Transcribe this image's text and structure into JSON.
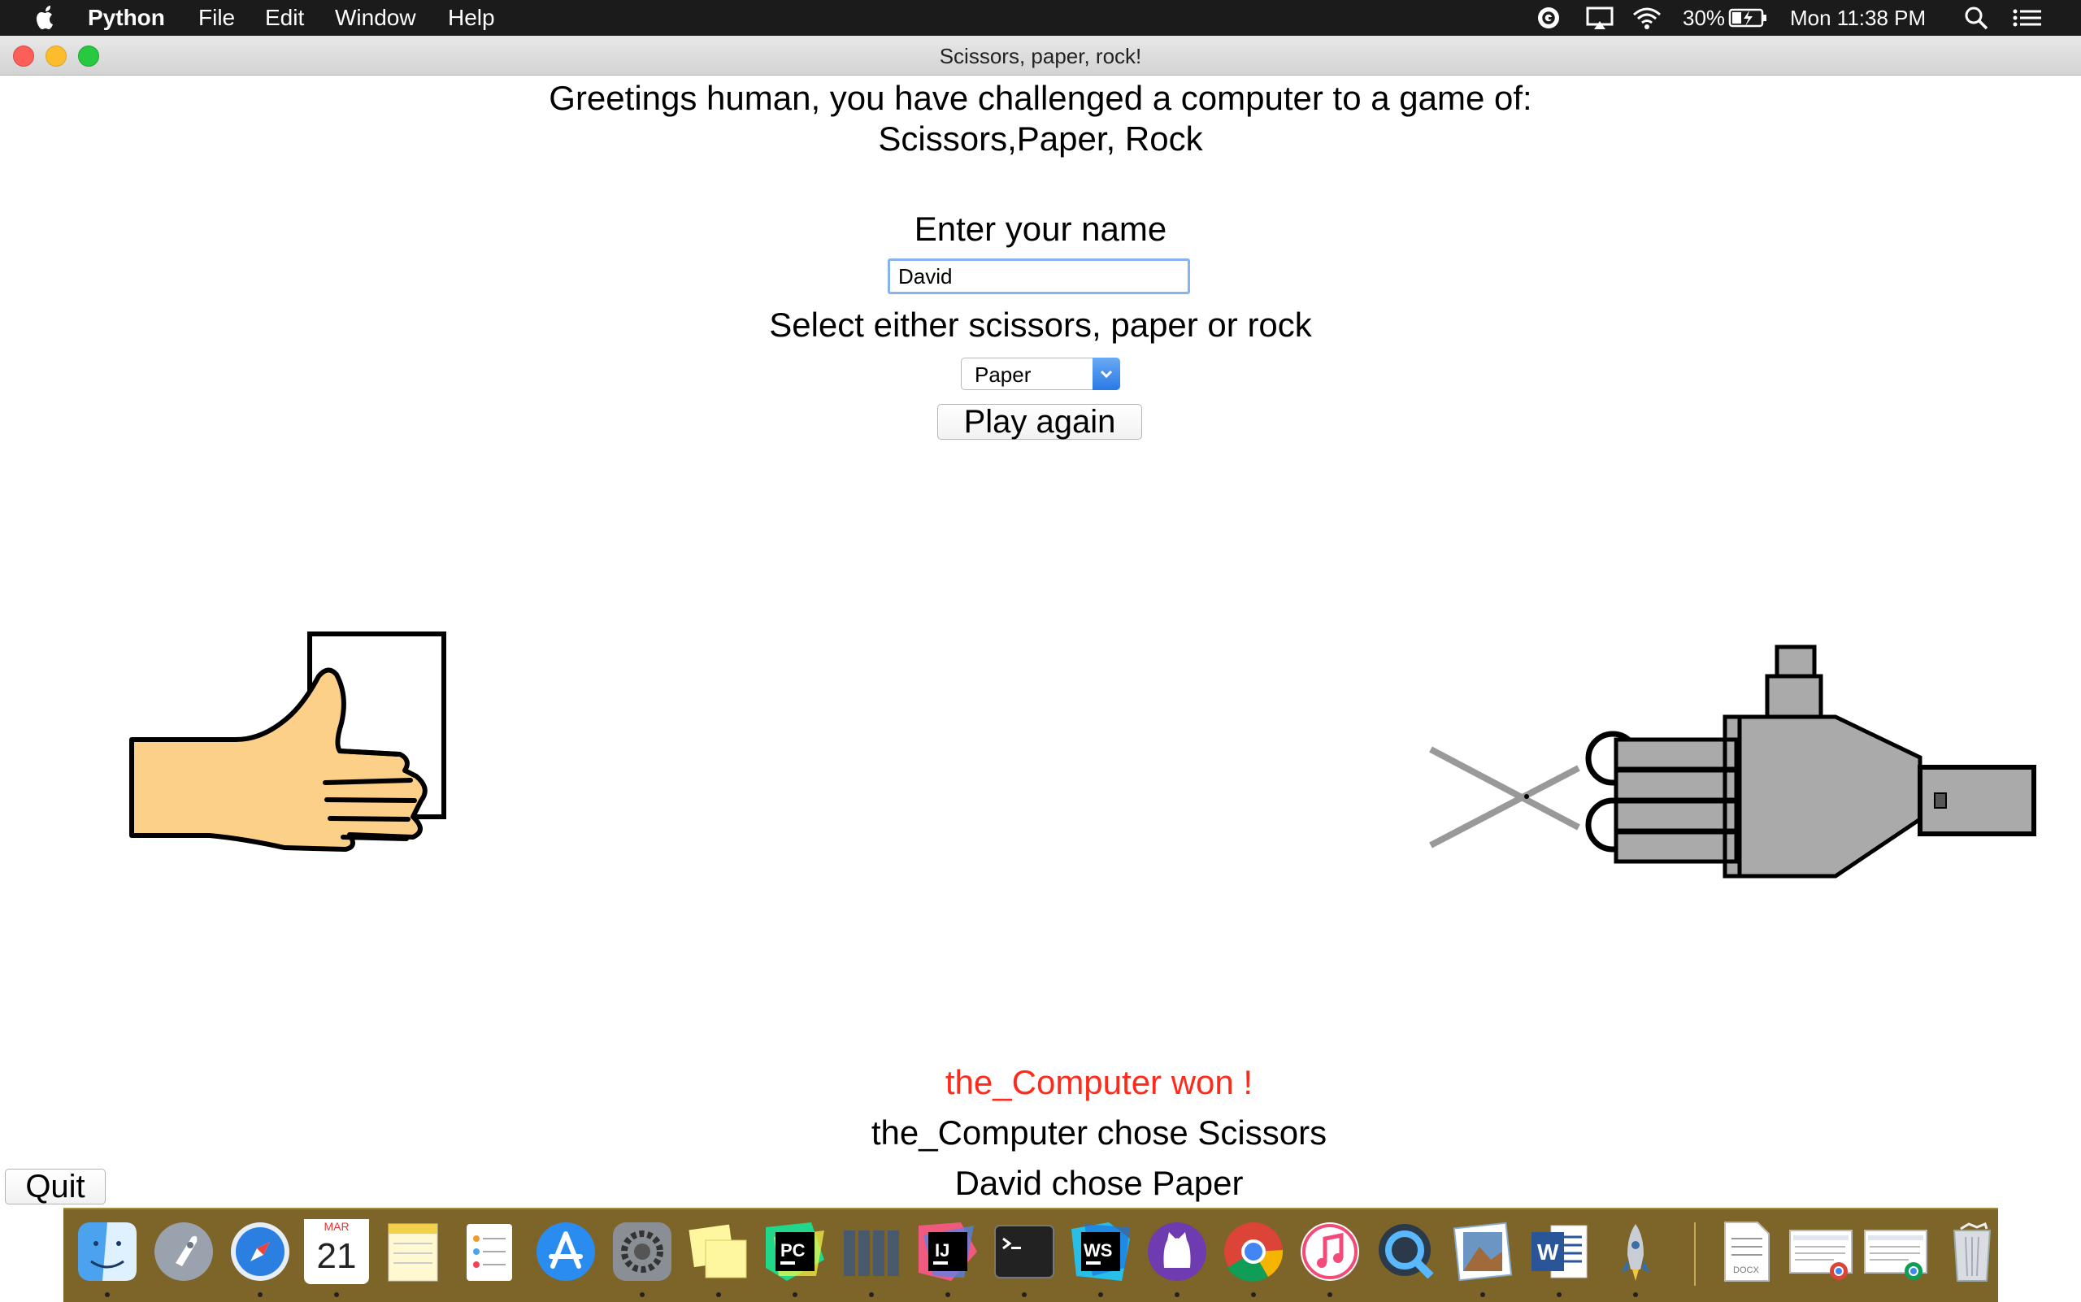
{
  "menubar": {
    "app_name": "Python",
    "menus": [
      "File",
      "Edit",
      "Window",
      "Help"
    ],
    "battery": "30%",
    "clock": "Mon 11:38 PM"
  },
  "window": {
    "title": "Scissors, paper, rock!"
  },
  "content": {
    "greeting_line1": "Greetings human, you have challenged a computer to a game of:",
    "greeting_line2": "Scissors,Paper, Rock",
    "name_label": "Enter your name",
    "name_value": "David",
    "select_label": "Select either scissors, paper or rock",
    "select_value": "Paper",
    "play_button": "Play again",
    "result": "the_Computer won !",
    "computer_choice": "the_Computer chose Scissors",
    "user_choice": "David chose Paper",
    "quit_button": "Quit"
  },
  "dock": {
    "calendar_month": "MAR",
    "calendar_day": "21",
    "items": [
      "finder-icon",
      "launchpad-icon",
      "safari-icon",
      "calendar-icon",
      "notes-icon",
      "reminders-icon",
      "app-store-icon",
      "system-preferences-icon",
      "stickies-icon",
      "pycharm-icon",
      "server-icon",
      "intellij-icon",
      "terminal-icon",
      "webstorm-icon",
      "github-desktop-icon",
      "chrome-icon",
      "itunes-icon",
      "quicktime-icon",
      "preview-icon",
      "word-icon",
      "python-launcher-icon",
      "docx-file-icon",
      "chrome-document-icon",
      "chrome-document-icon-2",
      "trash-icon"
    ]
  }
}
